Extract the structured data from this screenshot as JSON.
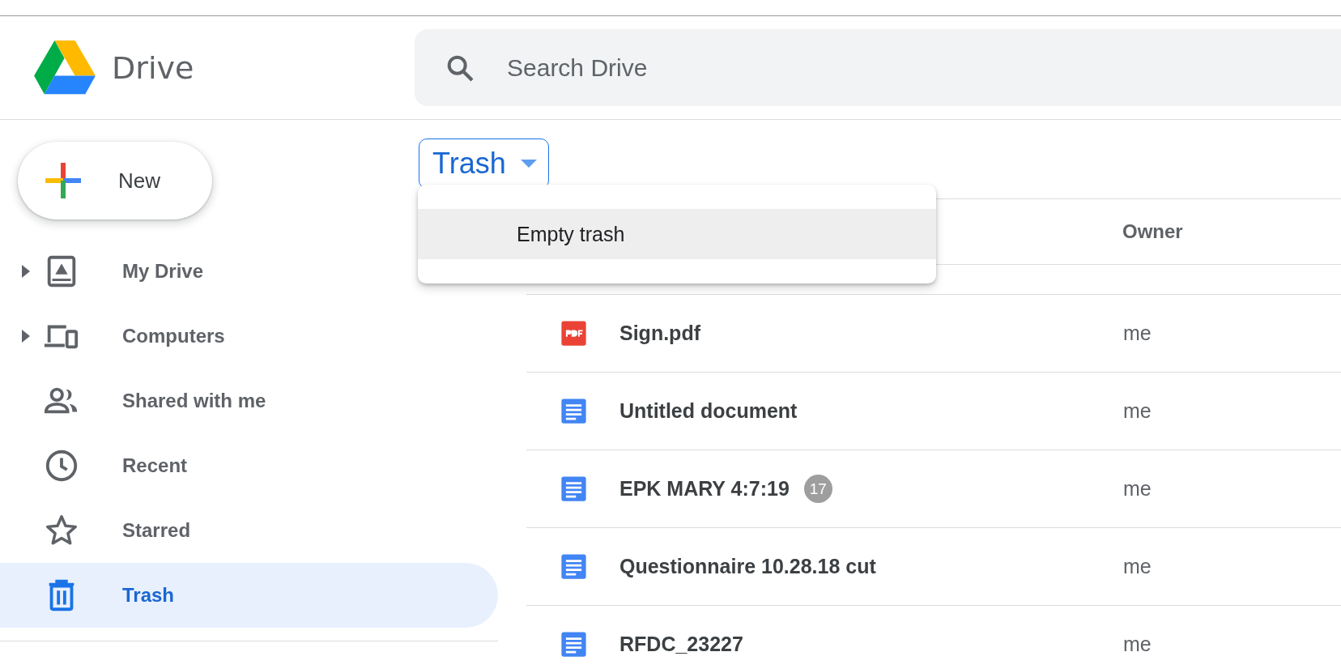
{
  "header": {
    "app_name": "Drive",
    "search": {
      "placeholder": "Search Drive"
    }
  },
  "new_button": {
    "label": "New"
  },
  "sidebar": {
    "items": [
      {
        "label": "My Drive",
        "kind": "drive",
        "expandable": true,
        "selected": false
      },
      {
        "label": "Computers",
        "kind": "computers",
        "expandable": true,
        "selected": false
      },
      {
        "label": "Shared with me",
        "kind": "shared",
        "expandable": false,
        "selected": false
      },
      {
        "label": "Recent",
        "kind": "recent",
        "expandable": false,
        "selected": false
      },
      {
        "label": "Starred",
        "kind": "starred",
        "expandable": false,
        "selected": false
      },
      {
        "label": "Trash",
        "kind": "trash",
        "expandable": false,
        "selected": true
      }
    ]
  },
  "location_chip": {
    "label": "Trash"
  },
  "menu": {
    "items": [
      {
        "label": "Empty trash",
        "selected": true
      }
    ]
  },
  "table": {
    "columns": [
      "Owner"
    ],
    "rows": [
      {
        "kind": "pdf",
        "name": "Sign.pdf",
        "owner": "me"
      },
      {
        "kind": "doc",
        "name": "Untitled document",
        "owner": "me"
      },
      {
        "kind": "doc",
        "name": "EPK MARY 4:7:19",
        "badge": "17",
        "owner": "me"
      },
      {
        "kind": "doc",
        "name": "Questionnaire 10.28.18 cut",
        "owner": "me"
      },
      {
        "kind": "doc",
        "name": "RFDC_23227",
        "owner": "me"
      }
    ]
  }
}
